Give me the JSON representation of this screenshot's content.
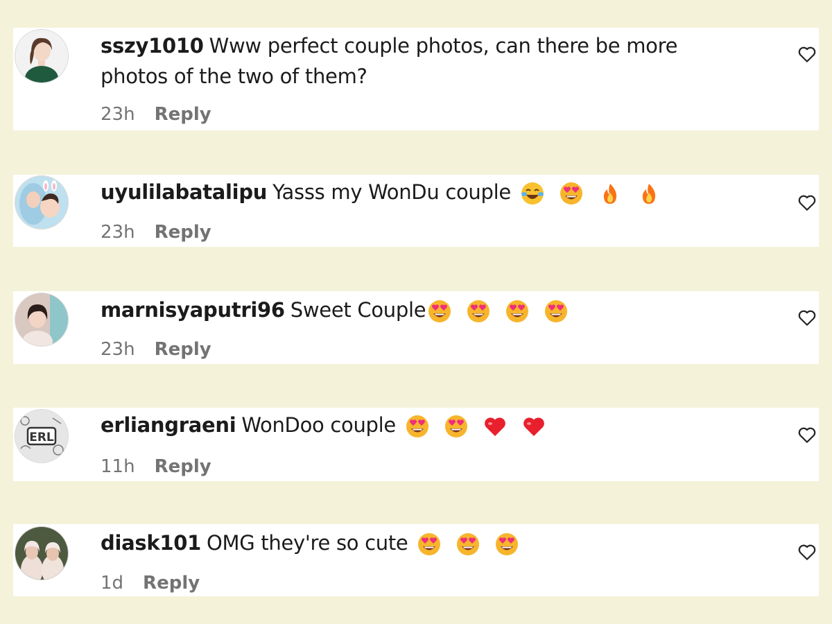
{
  "comments": [
    {
      "username": "sszy1010",
      "text": "Www perfect couple photos, can there be more photos of the two of them?",
      "emojis": [],
      "time": "23h",
      "reply_label": "Reply"
    },
    {
      "username": "uyulilabatalipu",
      "text": "Yasss my WonDu couple",
      "emojis": [
        "face-with-tears-of-joy",
        "star-struck-heart-eyes",
        "fire",
        "fire"
      ],
      "time": "23h",
      "reply_label": "Reply"
    },
    {
      "username": "marnisyaputri96",
      "text": "Sweet Couple",
      "emojis": [
        "star-struck-heart-eyes",
        "star-struck-heart-eyes",
        "star-struck-heart-eyes",
        "star-struck-heart-eyes"
      ],
      "time": "23h",
      "reply_label": "Reply"
    },
    {
      "username": "erliangraeni",
      "text": "WonDoo couple",
      "emojis": [
        "star-struck-heart-eyes",
        "star-struck-heart-eyes",
        "red-heart",
        "red-heart"
      ],
      "time": "11h",
      "reply_label": "Reply"
    },
    {
      "username": "diask101",
      "text": "OMG they're so cute",
      "emojis": [
        "star-struck-heart-eyes",
        "star-struck-heart-eyes",
        "star-struck-heart-eyes"
      ],
      "time": "1d",
      "reply_label": "Reply"
    }
  ],
  "icons": {
    "like": "heart-outline-icon"
  },
  "colors": {
    "page_background": "#f4f3da",
    "card_background": "#ffffff",
    "meta_text": "#737373"
  }
}
